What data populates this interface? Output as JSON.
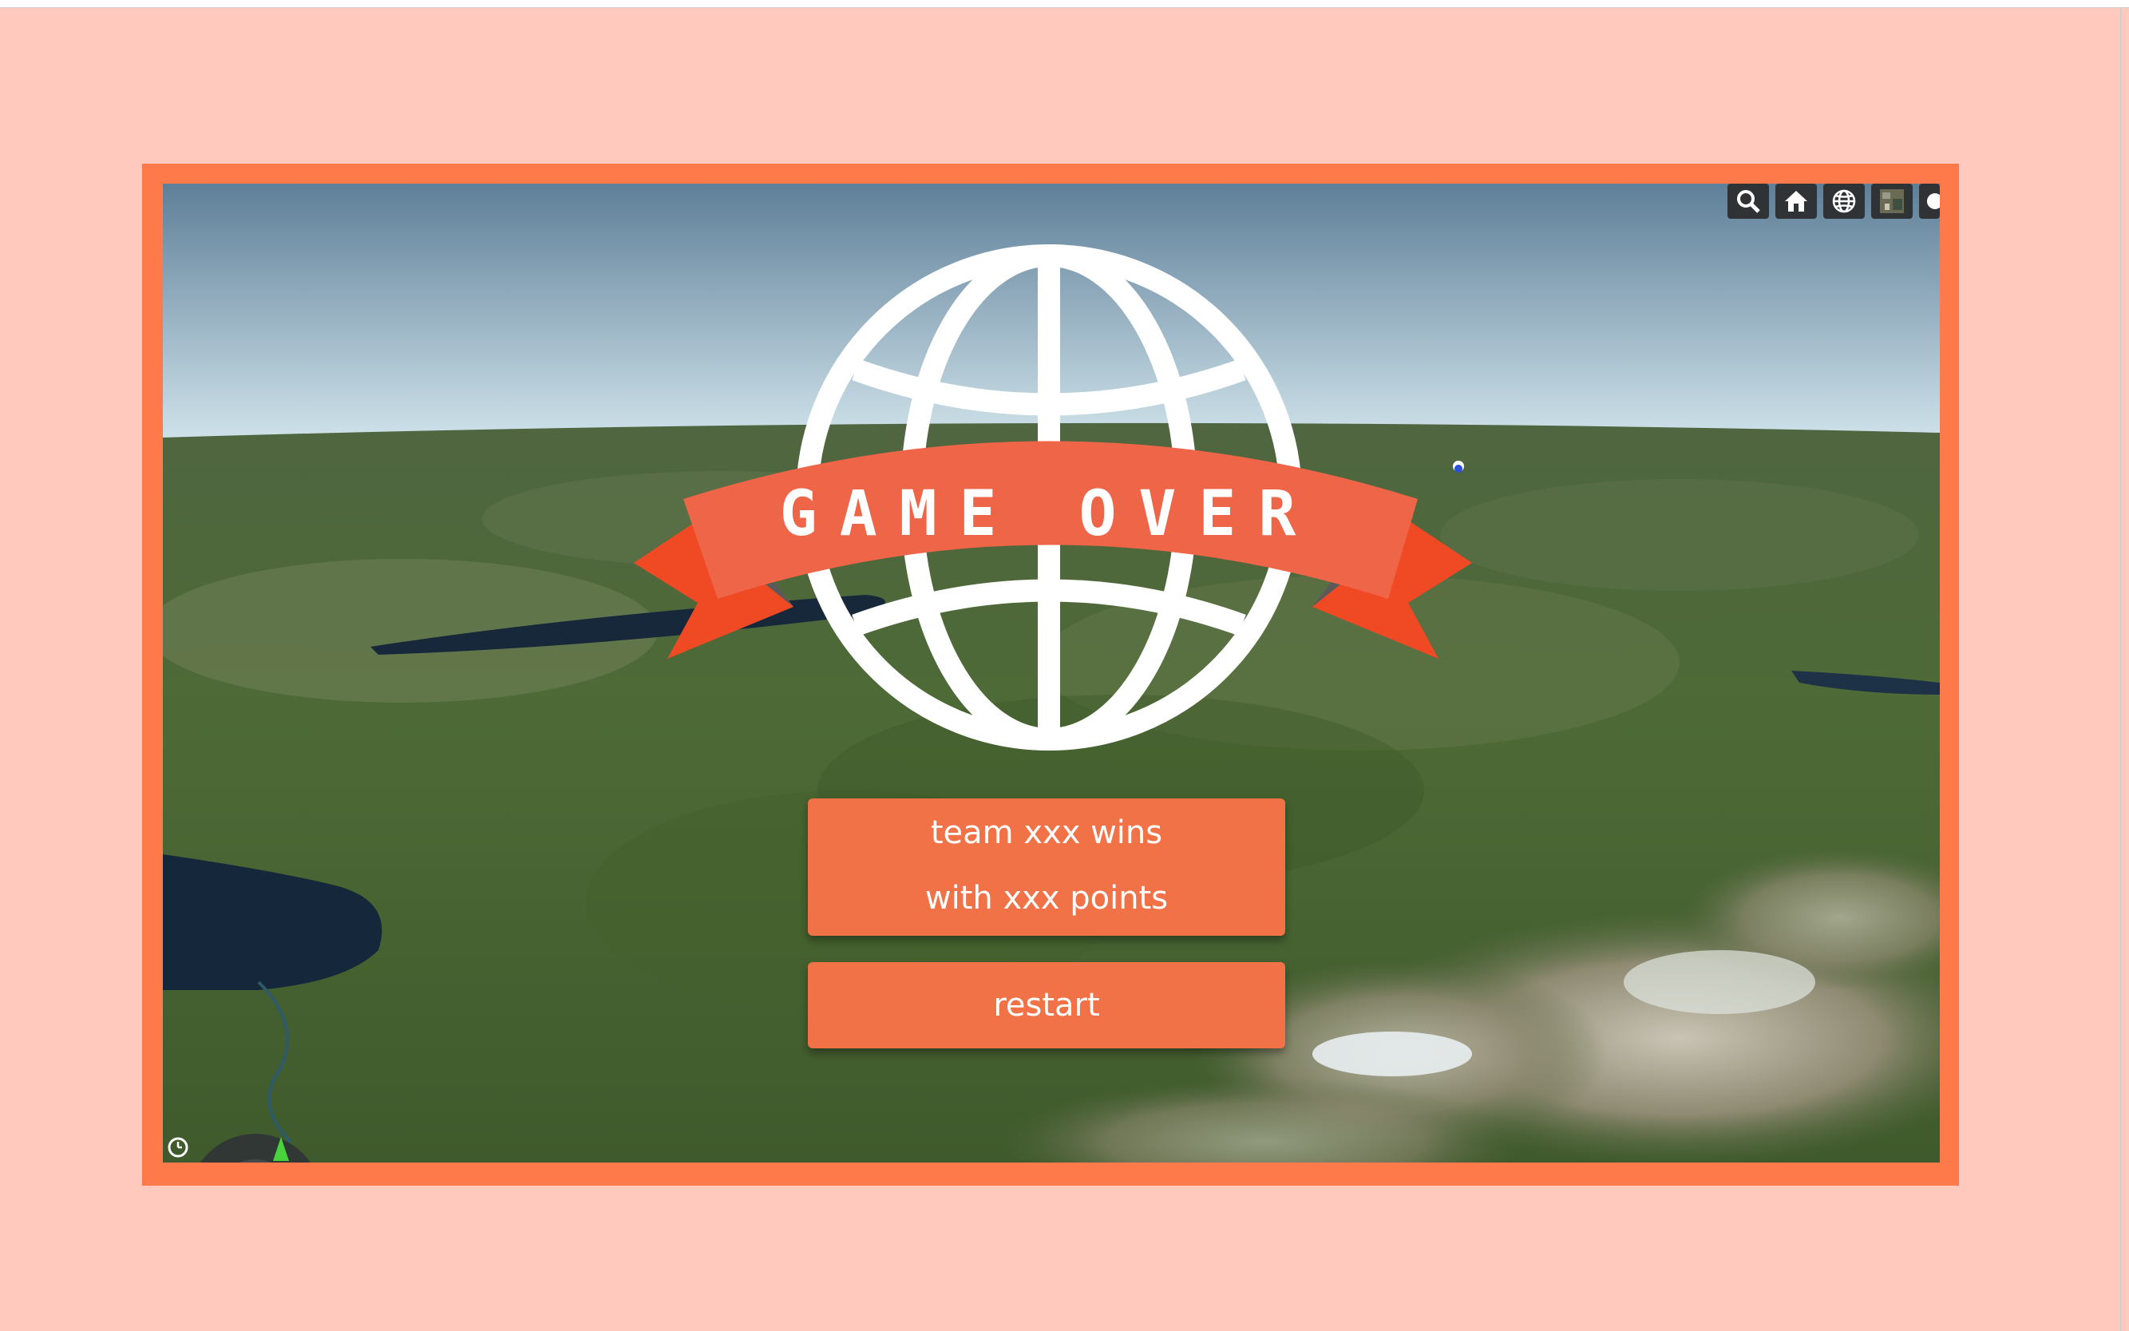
{
  "game": {
    "banner_text": "GAME OVER",
    "result_line1": "team xxx wins",
    "result_line2": "with xxx points",
    "restart_label": "restart"
  },
  "toolbar": {
    "buttons": [
      "search-icon",
      "home-icon",
      "globe-icon",
      "imagery-icon",
      "info-icon"
    ]
  },
  "colors": {
    "background": "#ffc9bd",
    "frame": "#ff7a4a",
    "button": "#f17246",
    "ribbon": "#ee6547",
    "ribbon_tail": "#f04a25"
  }
}
